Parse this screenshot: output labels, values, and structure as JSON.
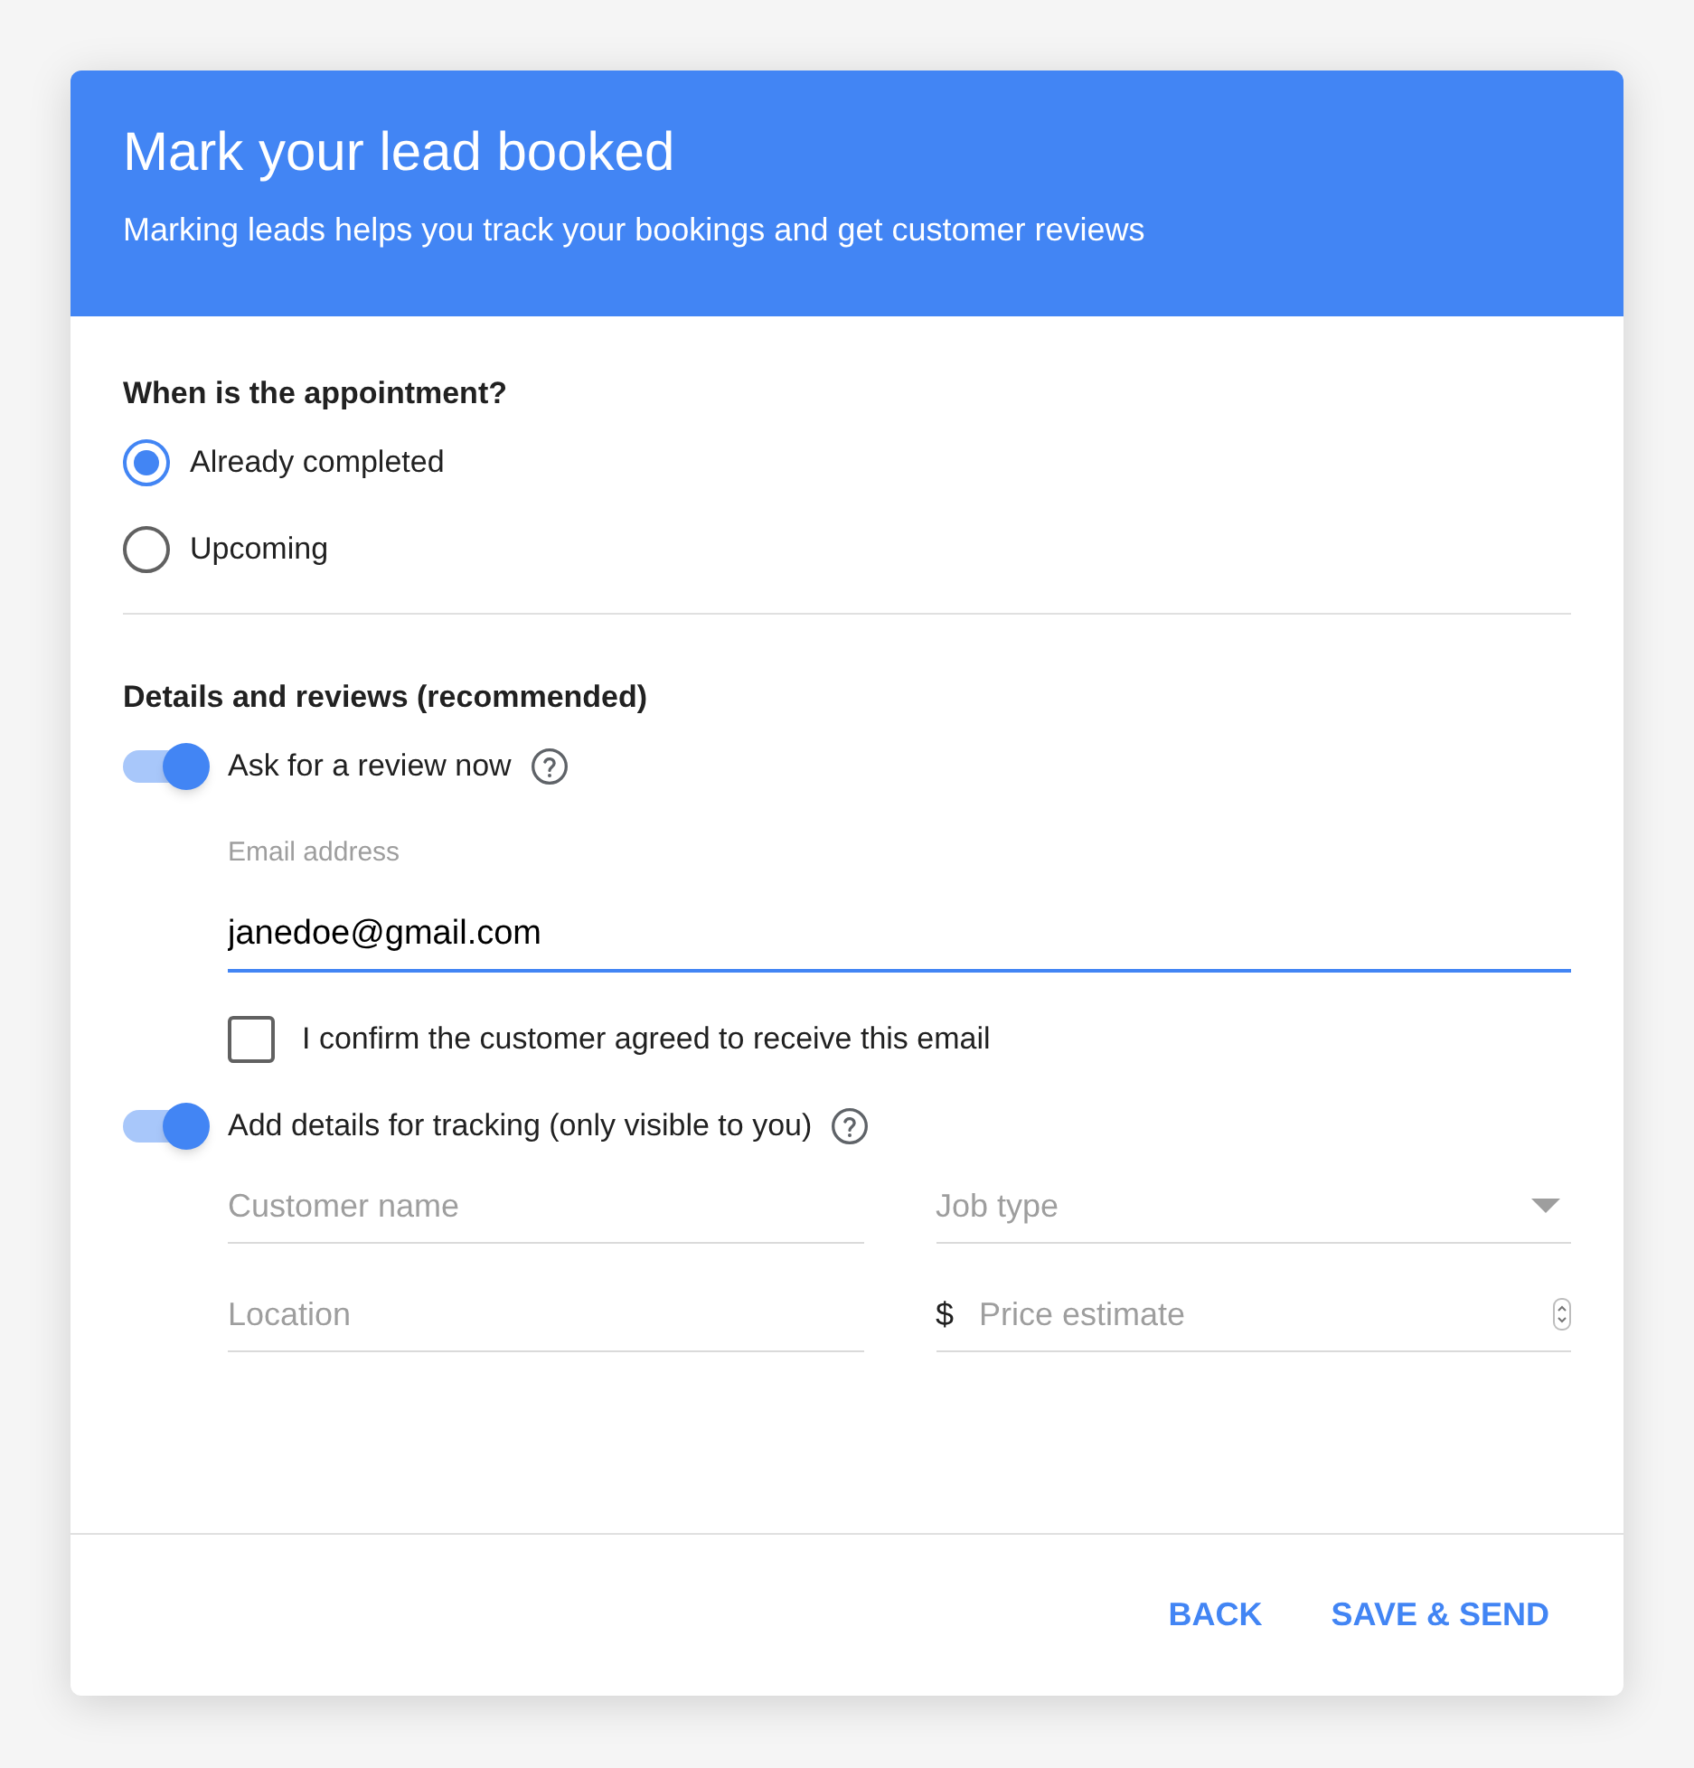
{
  "header": {
    "title": "Mark your lead booked",
    "subtitle": "Marking leads helps you track your bookings and get customer reviews"
  },
  "appointment": {
    "question": "When is the appointment?",
    "options": [
      {
        "label": "Already completed",
        "selected": true
      },
      {
        "label": "Upcoming",
        "selected": false
      }
    ]
  },
  "details": {
    "heading": "Details and reviews (recommended)",
    "review_toggle": {
      "label": "Ask for a review now",
      "on": true
    },
    "email": {
      "label": "Email address",
      "value": "janedoe@gmail.com",
      "focused": true
    },
    "confirm": {
      "label": "I confirm the customer agreed to receive this email",
      "checked": false
    },
    "tracking_toggle": {
      "label": "Add details for tracking (only visible to you)",
      "on": true
    },
    "fields": [
      {
        "kind": "text",
        "placeholder": "Customer name"
      },
      {
        "kind": "select",
        "placeholder": "Job type"
      },
      {
        "kind": "text",
        "placeholder": "Location"
      },
      {
        "kind": "currency",
        "prefix": "$",
        "placeholder": "Price estimate"
      }
    ]
  },
  "buttons": [
    "BACK",
    "SAVE & SEND"
  ]
}
